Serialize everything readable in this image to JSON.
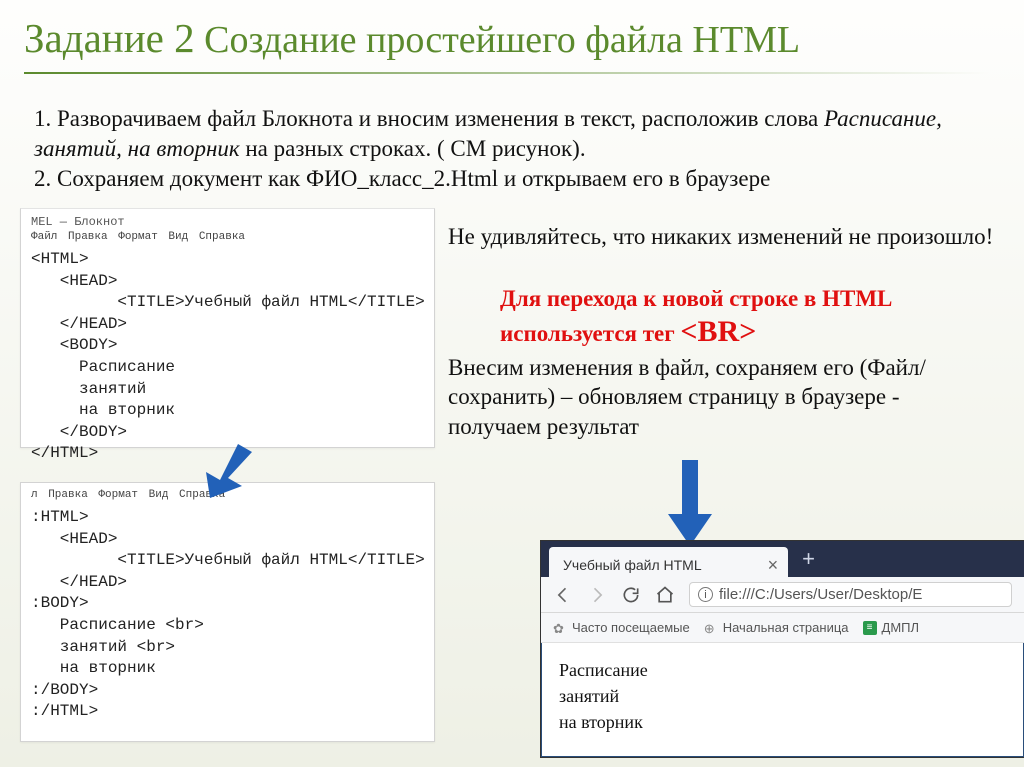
{
  "title_main": "Задание 2",
  "title_rest": "Создание простейшего файла HTML",
  "intro": {
    "p1a": "1. Разворачиваем файл Блокнота и вносим изменения в текст, расположив слова ",
    "p1b_ital": "Расписание, занятий, на вторник",
    "p1c": " на разных строках. ( СМ рисунок).",
    "p2": "2. Сохраняем документ как ФИО_класс_2.Html и открываем его в браузере"
  },
  "notepad1": {
    "title": "MEL — Блокнот",
    "menu": "Файл  Правка  Формат  Вид  Справка",
    "code": "<HTML>\n   <HEAD>\n         <TITLE>Учебный файл HTML</TITLE>\n   </HEAD>\n   <BODY>\n     Расписание\n     занятий\n     на вторник\n   </BODY>\n</HTML>"
  },
  "notepad2": {
    "menu": "л  Правка  Формат  Вид  Справка",
    "code": ":HTML>\n   <HEAD>\n         <TITLE>Учебный файл HTML</TITLE>\n   </HEAD>\n:BODY>\n   Расписание <br>\n   занятий <br>\n   на вторник\n:/BODY>\n:/HTML>"
  },
  "right": {
    "line1": "Не удивляйтесь, что никаких изменений не произошло!",
    "line2a": "Для перехода к новой строке в HTML используется тег ",
    "line2b": "<BR>",
    "line3": "Внесим изменения в файл, сохраняем его (Файл/сохранить) – обновляем страницу в браузере - получаем результат"
  },
  "browser": {
    "tab_title": "Учебный файл HTML",
    "newtab": "+",
    "url": "file:///C:/Users/User/Desktop/E",
    "bk1": "Часто посещаемые",
    "bk2": "Начальная страница",
    "bk3": "ДМПЛ",
    "page_l1": "Расписание",
    "page_l2": "занятий",
    "page_l3": "на вторник"
  }
}
